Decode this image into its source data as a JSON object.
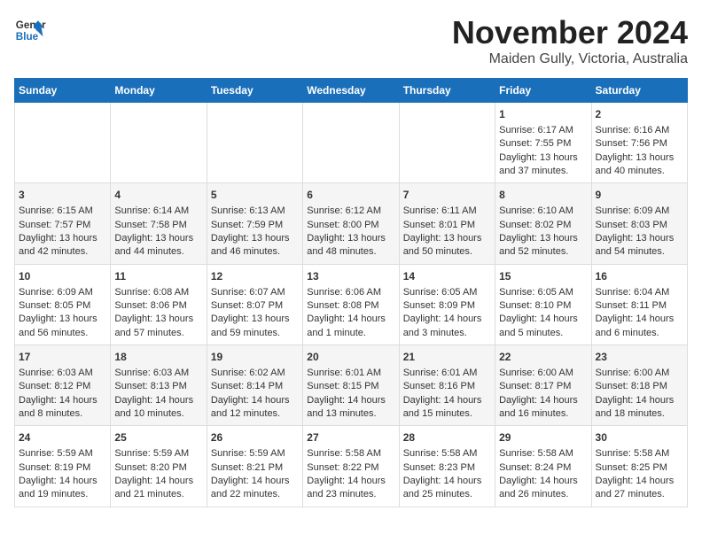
{
  "logo": {
    "line1": "General",
    "line2": "Blue"
  },
  "title": "November 2024",
  "subtitle": "Maiden Gully, Victoria, Australia",
  "days_header": [
    "Sunday",
    "Monday",
    "Tuesday",
    "Wednesday",
    "Thursday",
    "Friday",
    "Saturday"
  ],
  "weeks": [
    [
      {
        "day": "",
        "info": ""
      },
      {
        "day": "",
        "info": ""
      },
      {
        "day": "",
        "info": ""
      },
      {
        "day": "",
        "info": ""
      },
      {
        "day": "",
        "info": ""
      },
      {
        "day": "1",
        "info": "Sunrise: 6:17 AM\nSunset: 7:55 PM\nDaylight: 13 hours\nand 37 minutes."
      },
      {
        "day": "2",
        "info": "Sunrise: 6:16 AM\nSunset: 7:56 PM\nDaylight: 13 hours\nand 40 minutes."
      }
    ],
    [
      {
        "day": "3",
        "info": "Sunrise: 6:15 AM\nSunset: 7:57 PM\nDaylight: 13 hours\nand 42 minutes."
      },
      {
        "day": "4",
        "info": "Sunrise: 6:14 AM\nSunset: 7:58 PM\nDaylight: 13 hours\nand 44 minutes."
      },
      {
        "day": "5",
        "info": "Sunrise: 6:13 AM\nSunset: 7:59 PM\nDaylight: 13 hours\nand 46 minutes."
      },
      {
        "day": "6",
        "info": "Sunrise: 6:12 AM\nSunset: 8:00 PM\nDaylight: 13 hours\nand 48 minutes."
      },
      {
        "day": "7",
        "info": "Sunrise: 6:11 AM\nSunset: 8:01 PM\nDaylight: 13 hours\nand 50 minutes."
      },
      {
        "day": "8",
        "info": "Sunrise: 6:10 AM\nSunset: 8:02 PM\nDaylight: 13 hours\nand 52 minutes."
      },
      {
        "day": "9",
        "info": "Sunrise: 6:09 AM\nSunset: 8:03 PM\nDaylight: 13 hours\nand 54 minutes."
      }
    ],
    [
      {
        "day": "10",
        "info": "Sunrise: 6:09 AM\nSunset: 8:05 PM\nDaylight: 13 hours\nand 56 minutes."
      },
      {
        "day": "11",
        "info": "Sunrise: 6:08 AM\nSunset: 8:06 PM\nDaylight: 13 hours\nand 57 minutes."
      },
      {
        "day": "12",
        "info": "Sunrise: 6:07 AM\nSunset: 8:07 PM\nDaylight: 13 hours\nand 59 minutes."
      },
      {
        "day": "13",
        "info": "Sunrise: 6:06 AM\nSunset: 8:08 PM\nDaylight: 14 hours\nand 1 minute."
      },
      {
        "day": "14",
        "info": "Sunrise: 6:05 AM\nSunset: 8:09 PM\nDaylight: 14 hours\nand 3 minutes."
      },
      {
        "day": "15",
        "info": "Sunrise: 6:05 AM\nSunset: 8:10 PM\nDaylight: 14 hours\nand 5 minutes."
      },
      {
        "day": "16",
        "info": "Sunrise: 6:04 AM\nSunset: 8:11 PM\nDaylight: 14 hours\nand 6 minutes."
      }
    ],
    [
      {
        "day": "17",
        "info": "Sunrise: 6:03 AM\nSunset: 8:12 PM\nDaylight: 14 hours\nand 8 minutes."
      },
      {
        "day": "18",
        "info": "Sunrise: 6:03 AM\nSunset: 8:13 PM\nDaylight: 14 hours\nand 10 minutes."
      },
      {
        "day": "19",
        "info": "Sunrise: 6:02 AM\nSunset: 8:14 PM\nDaylight: 14 hours\nand 12 minutes."
      },
      {
        "day": "20",
        "info": "Sunrise: 6:01 AM\nSunset: 8:15 PM\nDaylight: 14 hours\nand 13 minutes."
      },
      {
        "day": "21",
        "info": "Sunrise: 6:01 AM\nSunset: 8:16 PM\nDaylight: 14 hours\nand 15 minutes."
      },
      {
        "day": "22",
        "info": "Sunrise: 6:00 AM\nSunset: 8:17 PM\nDaylight: 14 hours\nand 16 minutes."
      },
      {
        "day": "23",
        "info": "Sunrise: 6:00 AM\nSunset: 8:18 PM\nDaylight: 14 hours\nand 18 minutes."
      }
    ],
    [
      {
        "day": "24",
        "info": "Sunrise: 5:59 AM\nSunset: 8:19 PM\nDaylight: 14 hours\nand 19 minutes."
      },
      {
        "day": "25",
        "info": "Sunrise: 5:59 AM\nSunset: 8:20 PM\nDaylight: 14 hours\nand 21 minutes."
      },
      {
        "day": "26",
        "info": "Sunrise: 5:59 AM\nSunset: 8:21 PM\nDaylight: 14 hours\nand 22 minutes."
      },
      {
        "day": "27",
        "info": "Sunrise: 5:58 AM\nSunset: 8:22 PM\nDaylight: 14 hours\nand 23 minutes."
      },
      {
        "day": "28",
        "info": "Sunrise: 5:58 AM\nSunset: 8:23 PM\nDaylight: 14 hours\nand 25 minutes."
      },
      {
        "day": "29",
        "info": "Sunrise: 5:58 AM\nSunset: 8:24 PM\nDaylight: 14 hours\nand 26 minutes."
      },
      {
        "day": "30",
        "info": "Sunrise: 5:58 AM\nSunset: 8:25 PM\nDaylight: 14 hours\nand 27 minutes."
      }
    ]
  ],
  "accent_color": "#1a6fba"
}
